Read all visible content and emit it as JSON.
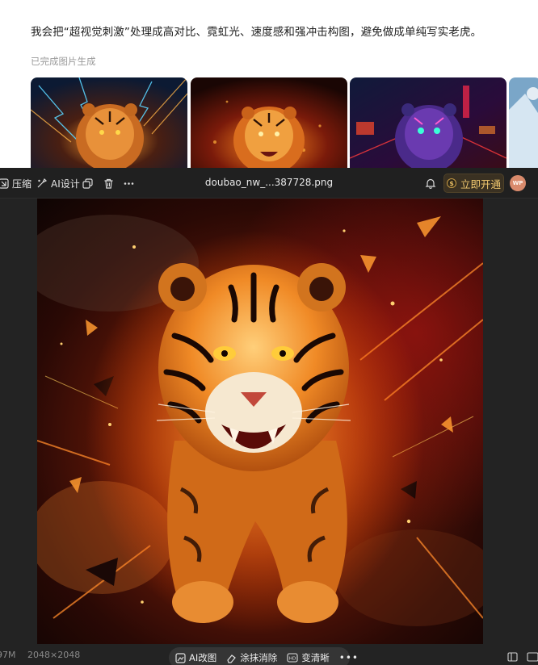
{
  "chat": {
    "message": "我会把“超视觉刺激”处理成高对比、霓虹光、速度感和强冲击构图，避免做成单纯写实老虎。",
    "status": "已完成图片生成"
  },
  "toolbar": {
    "compress_label": "压缩",
    "ai_design_label": "AI设计",
    "file_name": "doubao_nw_...387728.png",
    "vip_label": "立即开通",
    "vip_coin": "$",
    "avatar_initials": "WP"
  },
  "bottom": {
    "file_size": "97M",
    "dimensions": "2048×2048",
    "ai_edit_label": "AI改图",
    "erase_label": "涂抹消除",
    "sharpen_label": "变清晰",
    "more_label": "•••"
  },
  "colors": {
    "viewer_bg": "#232323",
    "vip_text": "#f0c76e",
    "fire_orange": "#ff7a1a"
  },
  "icons": {
    "compress": "compress-icon",
    "ai_design": "ai-design-icon",
    "copy": "copy-icon",
    "delete": "trash-icon",
    "more": "more-icon",
    "bell": "bell-icon"
  }
}
